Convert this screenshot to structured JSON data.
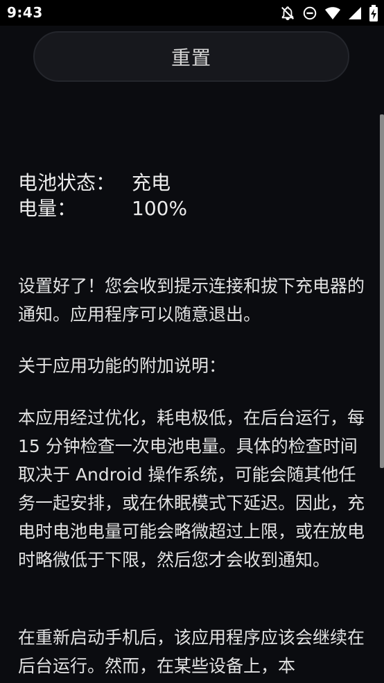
{
  "status_bar": {
    "time": "9:43",
    "icons": [
      "notifications-off-icon",
      "do-not-disturb-icon",
      "wifi-icon",
      "signal-icon",
      "battery-charging-icon"
    ]
  },
  "reset_button": {
    "label": "重置"
  },
  "battery_info": {
    "status_label": "电池状态：",
    "status_value": "充电",
    "level_label": "电量：",
    "level_value": "100%"
  },
  "paragraphs": {
    "setup_done": "设置好了！您会收到提示连接和拔下充电器的通知。应用程序可以随意退出。",
    "extra_title": "关于应用功能的附加说明：",
    "optimization": "本应用经过优化，耗电极低，在后台运行，每 15 分钟检查一次电池电量。具体的检查时间取决于 Android 操作系统，可能会随其他任务一起安排，或在休眠模式下延迟。因此，充电时电池电量可能会略微超过上限，或在放电时略微低于下限，然后您才会收到通知。",
    "restart": "在重新启动手机后，该应用程序应该会继续在后台运行。然而，在某些设备上，本"
  },
  "colors": {
    "background": "#0b0c10",
    "status_bar": "#000000",
    "button_fill": "#17181d",
    "text": "#e6e6e6"
  }
}
